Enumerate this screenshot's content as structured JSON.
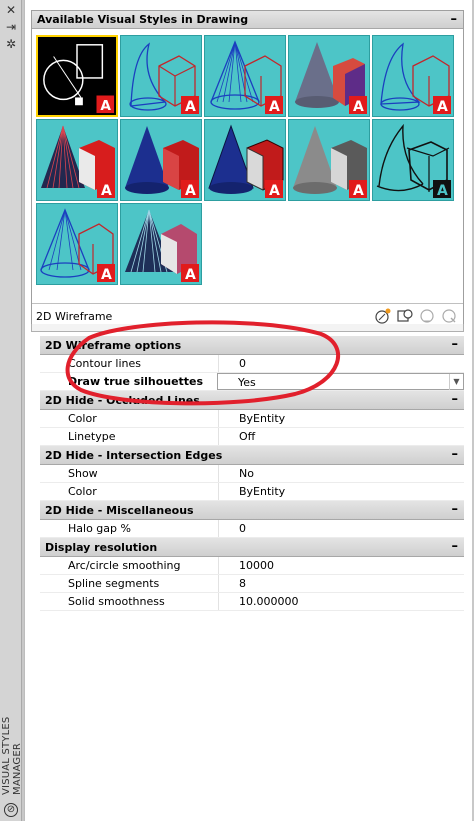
{
  "sidebar": {
    "title": "VISUAL STYLES MANAGER",
    "buttons": [
      "close-icon",
      "auto-hide-icon",
      "properties-icon"
    ]
  },
  "gallery": {
    "title": "Available Visual Styles in Drawing",
    "collapse_glyph": "–",
    "selected_name": "2D Wireframe",
    "thumb_badge": "A",
    "colors": {
      "thumb_bg": "#4dc5c7",
      "selected_border": "#ffd200",
      "badge_red": "#e11b1b"
    }
  },
  "groups": [
    {
      "title": "2D Wireframe options",
      "collapse_glyph": "–",
      "rows": [
        {
          "name": "Contour lines",
          "value": "0"
        },
        {
          "name": "Draw true silhouettes",
          "value": "Yes",
          "dropdown": true
        }
      ]
    },
    {
      "title": "2D Hide - Occluded Lines",
      "collapse_glyph": "–",
      "rows": [
        {
          "name": "Color",
          "value": "ByEntity"
        },
        {
          "name": "Linetype",
          "value": "Off"
        }
      ]
    },
    {
      "title": "2D Hide - Intersection Edges",
      "collapse_glyph": "–",
      "rows": [
        {
          "name": "Show",
          "value": "No"
        },
        {
          "name": "Color",
          "value": "ByEntity"
        }
      ]
    },
    {
      "title": "2D Hide - Miscellaneous",
      "collapse_glyph": "–",
      "rows": [
        {
          "name": "Halo gap %",
          "value": "0"
        }
      ]
    },
    {
      "title": "Display resolution",
      "collapse_glyph": "–",
      "rows": [
        {
          "name": "Arc/circle smoothing",
          "value": "10000"
        },
        {
          "name": "Spline segments",
          "value": "8"
        },
        {
          "name": "Solid smoothness",
          "value": "10.000000"
        }
      ]
    }
  ]
}
